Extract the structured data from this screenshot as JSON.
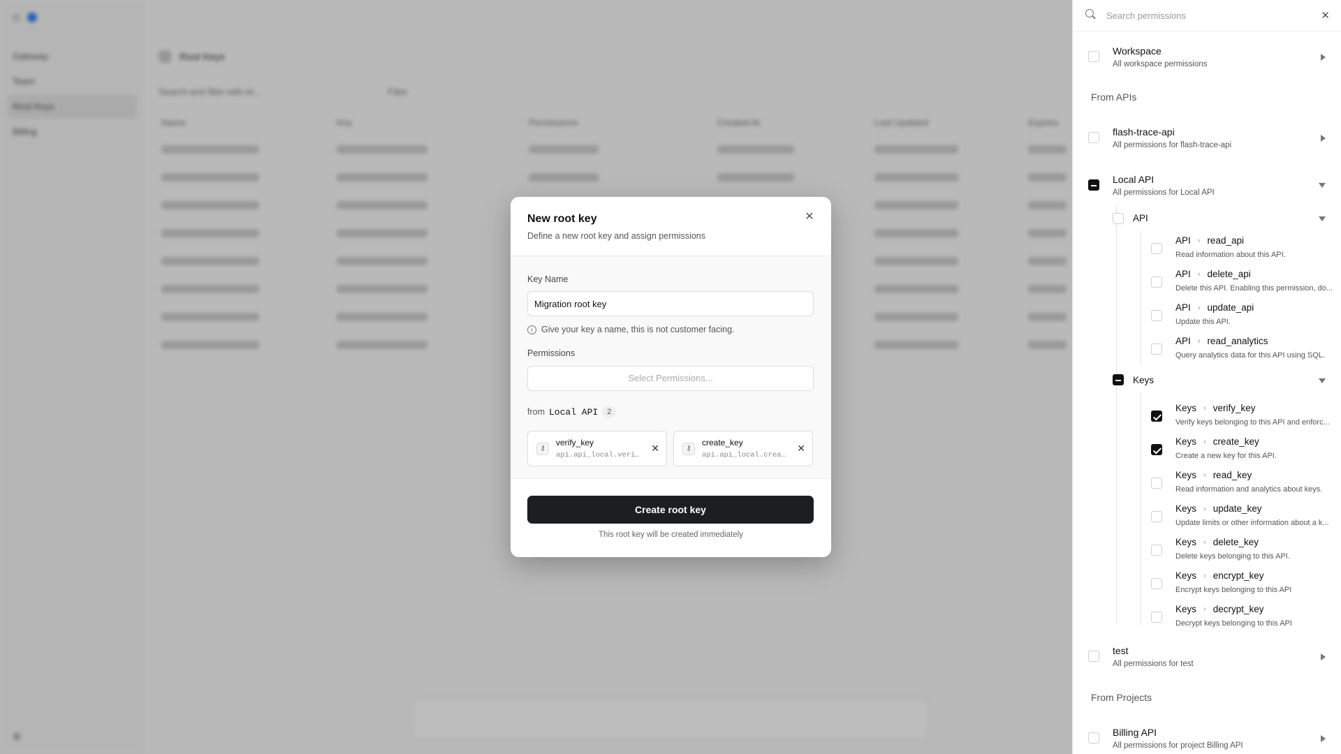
{
  "background": {
    "nav": [
      "Gateway",
      "Team",
      "Root Keys",
      "Billing"
    ],
    "page_title": "Root Keys",
    "search_placeholder": "Search and filter with AI...",
    "filter_label": "Filter",
    "columns": [
      "Name",
      "Key",
      "Permissions",
      "Created At",
      "Last Updated",
      "Expires"
    ]
  },
  "modal": {
    "title": "New root key",
    "description": "Define a new root key and assign permissions",
    "key_name_label": "Key Name",
    "key_name_value": "Migration root key",
    "key_name_hint": "Give your key a name, this is not customer facing.",
    "permissions_label": "Permissions",
    "permissions_placeholder": "Select Permissions...",
    "from_prefix": "from",
    "from_api": "Local API",
    "from_count": "2",
    "selected": [
      {
        "name": "verify_key",
        "id": "api.api_local.verify_key"
      },
      {
        "name": "create_key",
        "id": "api.api_local.create_key"
      }
    ],
    "create_label": "Create root key",
    "footnote": "This root key will be created immediately"
  },
  "panel": {
    "search_placeholder": "Search permissions",
    "workspace": {
      "title": "Workspace",
      "desc": "All workspace permissions"
    },
    "from_apis_label": "From APIs",
    "flash": {
      "title": "flash-trace-api",
      "desc": "All permissions for flash-trace-api"
    },
    "local": {
      "title": "Local API",
      "desc": "All permissions for Local API"
    },
    "api_group": {
      "title": "API",
      "items": [
        {
          "cat": "API",
          "name": "read_api",
          "desc": "Read information about this API."
        },
        {
          "cat": "API",
          "name": "delete_api",
          "desc": "Delete this API. Enabling this permission, do..."
        },
        {
          "cat": "API",
          "name": "update_api",
          "desc": "Update this API."
        },
        {
          "cat": "API",
          "name": "read_analytics",
          "desc": "Query analytics data for this API using SQL."
        }
      ]
    },
    "keys_group": {
      "title": "Keys",
      "items": [
        {
          "cat": "Keys",
          "name": "verify_key",
          "desc": "Verify keys belonging to this API and enforc...",
          "checked": true
        },
        {
          "cat": "Keys",
          "name": "create_key",
          "desc": "Create a new key for this API.",
          "checked": true
        },
        {
          "cat": "Keys",
          "name": "read_key",
          "desc": "Read information and analytics about keys.",
          "checked": false
        },
        {
          "cat": "Keys",
          "name": "update_key",
          "desc": "Update limits or other information about a k...",
          "checked": false
        },
        {
          "cat": "Keys",
          "name": "delete_key",
          "desc": "Delete keys belonging to this API.",
          "checked": false
        },
        {
          "cat": "Keys",
          "name": "encrypt_key",
          "desc": "Encrypt keys belonging to this API",
          "checked": false
        },
        {
          "cat": "Keys",
          "name": "decrypt_key",
          "desc": "Decrypt keys belonging to this API",
          "checked": false
        }
      ]
    },
    "test": {
      "title": "test",
      "desc": "All permissions for test"
    },
    "from_projects_label": "From Projects",
    "billing": {
      "title": "Billing API",
      "desc": "All permissions for project Billing API"
    }
  }
}
